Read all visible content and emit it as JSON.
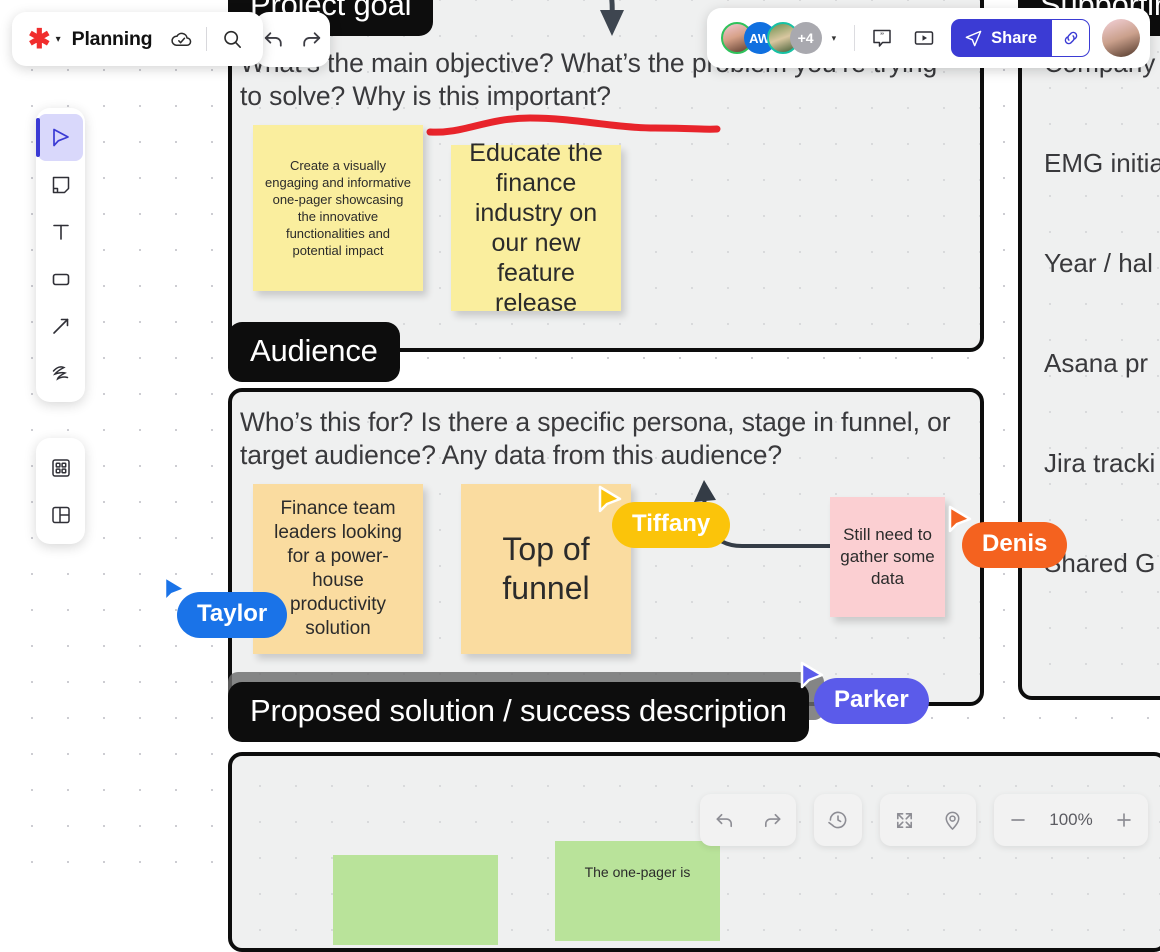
{
  "app": {
    "logo_icon": "asterisk-logo",
    "board_title": "Planning",
    "cloud_icon": "cloud-saved-icon",
    "search_icon": "search-icon",
    "dropdown_caret": "▾"
  },
  "undo_redo": {
    "undo_icon": "undo-arrow-icon",
    "redo_icon": "redo-arrow-icon"
  },
  "collaborators": {
    "avatars": [
      {
        "name": "avatar-user-1",
        "initials": "",
        "type": "photo",
        "ring": "green"
      },
      {
        "name": "avatar-user-2",
        "initials": "AW",
        "type": "initials",
        "ring": "none"
      },
      {
        "name": "avatar-user-3",
        "initials": "",
        "type": "photo",
        "ring": "teal"
      }
    ],
    "overflow_label": "+4",
    "caret": "▾",
    "comment_icon": "comment-icon",
    "present_icon": "present-play-icon",
    "share_label": "Share",
    "share_icon": "send-plane-icon",
    "copy_link_icon": "link-icon",
    "me_avatar": "current-user-avatar"
  },
  "toolbar": {
    "tools": [
      {
        "name": "select-tool",
        "icon": "cursor-arrow-icon",
        "active": true
      },
      {
        "name": "sticky-note-tool",
        "icon": "sticky-note-icon",
        "active": false
      },
      {
        "name": "text-tool",
        "icon": "text-T-icon",
        "active": false
      },
      {
        "name": "shape-tool",
        "icon": "rectangle-icon",
        "active": false
      },
      {
        "name": "connector-tool",
        "icon": "arrow-line-icon",
        "active": false
      },
      {
        "name": "pen-tool",
        "icon": "scribble-pen-icon",
        "active": false
      }
    ],
    "extras": [
      {
        "name": "apps-tool",
        "icon": "grid-apps-icon"
      },
      {
        "name": "templates-tool",
        "icon": "template-panel-icon"
      }
    ]
  },
  "bottom_bar": {
    "undo_icon": "undo-arrow-icon",
    "redo_icon": "redo-arrow-icon",
    "history_icon": "history-clock-icon",
    "fit_icon": "fit-to-screen-icon",
    "locate_icon": "location-pin-icon",
    "zoom_out_label": "−",
    "zoom_level": "100%",
    "zoom_in_label": "+"
  },
  "board": {
    "frames": [
      {
        "name": "frame-project-goal",
        "label": "Project goal",
        "question": "What’s the main objective? What’s the problem you’re trying to solve? Why is this important?"
      },
      {
        "name": "frame-audience",
        "label": "Audience",
        "question": "Who’s this for? Is there a specific persona, stage in funnel, or target audience? Any data from this audience?"
      },
      {
        "name": "frame-proposed-solution",
        "label": "Proposed solution / success description",
        "question": ""
      },
      {
        "name": "frame-supporting",
        "label": "Supporting",
        "items": [
          "Company",
          "EMG initia",
          "Year / hal",
          "Asana pr",
          "Jira tracki",
          "Shared G"
        ]
      }
    ],
    "stickies": [
      {
        "name": "sticky-create-one-pager",
        "text": "Create a visually engaging and informative one-pager showcasing the innovative functionalities and potential impact",
        "color": "#faee9e",
        "font_size": 13
      },
      {
        "name": "sticky-educate-finance",
        "text": "Educate the finance industry on our new feature release",
        "color": "#faee9e",
        "font_size": 25
      },
      {
        "name": "sticky-finance-team-leaders",
        "text": "Finance team leaders looking for a power-house productivity solution",
        "color": "#fadca0",
        "font_size": 19
      },
      {
        "name": "sticky-top-of-funnel",
        "text": "Top of funnel",
        "color": "#fadca0",
        "font_size": 32
      },
      {
        "name": "sticky-still-need-data",
        "text": "Still need to gather some data",
        "color": "#fbcfd2",
        "font_size": 17
      },
      {
        "name": "sticky-one-pager-green",
        "text": "The one-pager is",
        "color": "#b9e39a",
        "font_size": 14
      }
    ],
    "cursors": [
      {
        "name": "cursor-taylor",
        "label": "Taylor",
        "color": "#1a73e8"
      },
      {
        "name": "cursor-tiffany",
        "label": "Tiffany",
        "color": "#fbc40a"
      },
      {
        "name": "cursor-denis",
        "label": "Denis",
        "color": "#f4621f"
      },
      {
        "name": "cursor-parker",
        "label": "Parker",
        "color": "#5b5bea"
      }
    ],
    "annotations": [
      {
        "name": "red-underline-annotation",
        "color": "#e8242b"
      },
      {
        "name": "curved-down-arrow-annotation",
        "color": "#3e4650"
      },
      {
        "name": "connector-line-annotation",
        "color": "#343c46"
      }
    ]
  }
}
